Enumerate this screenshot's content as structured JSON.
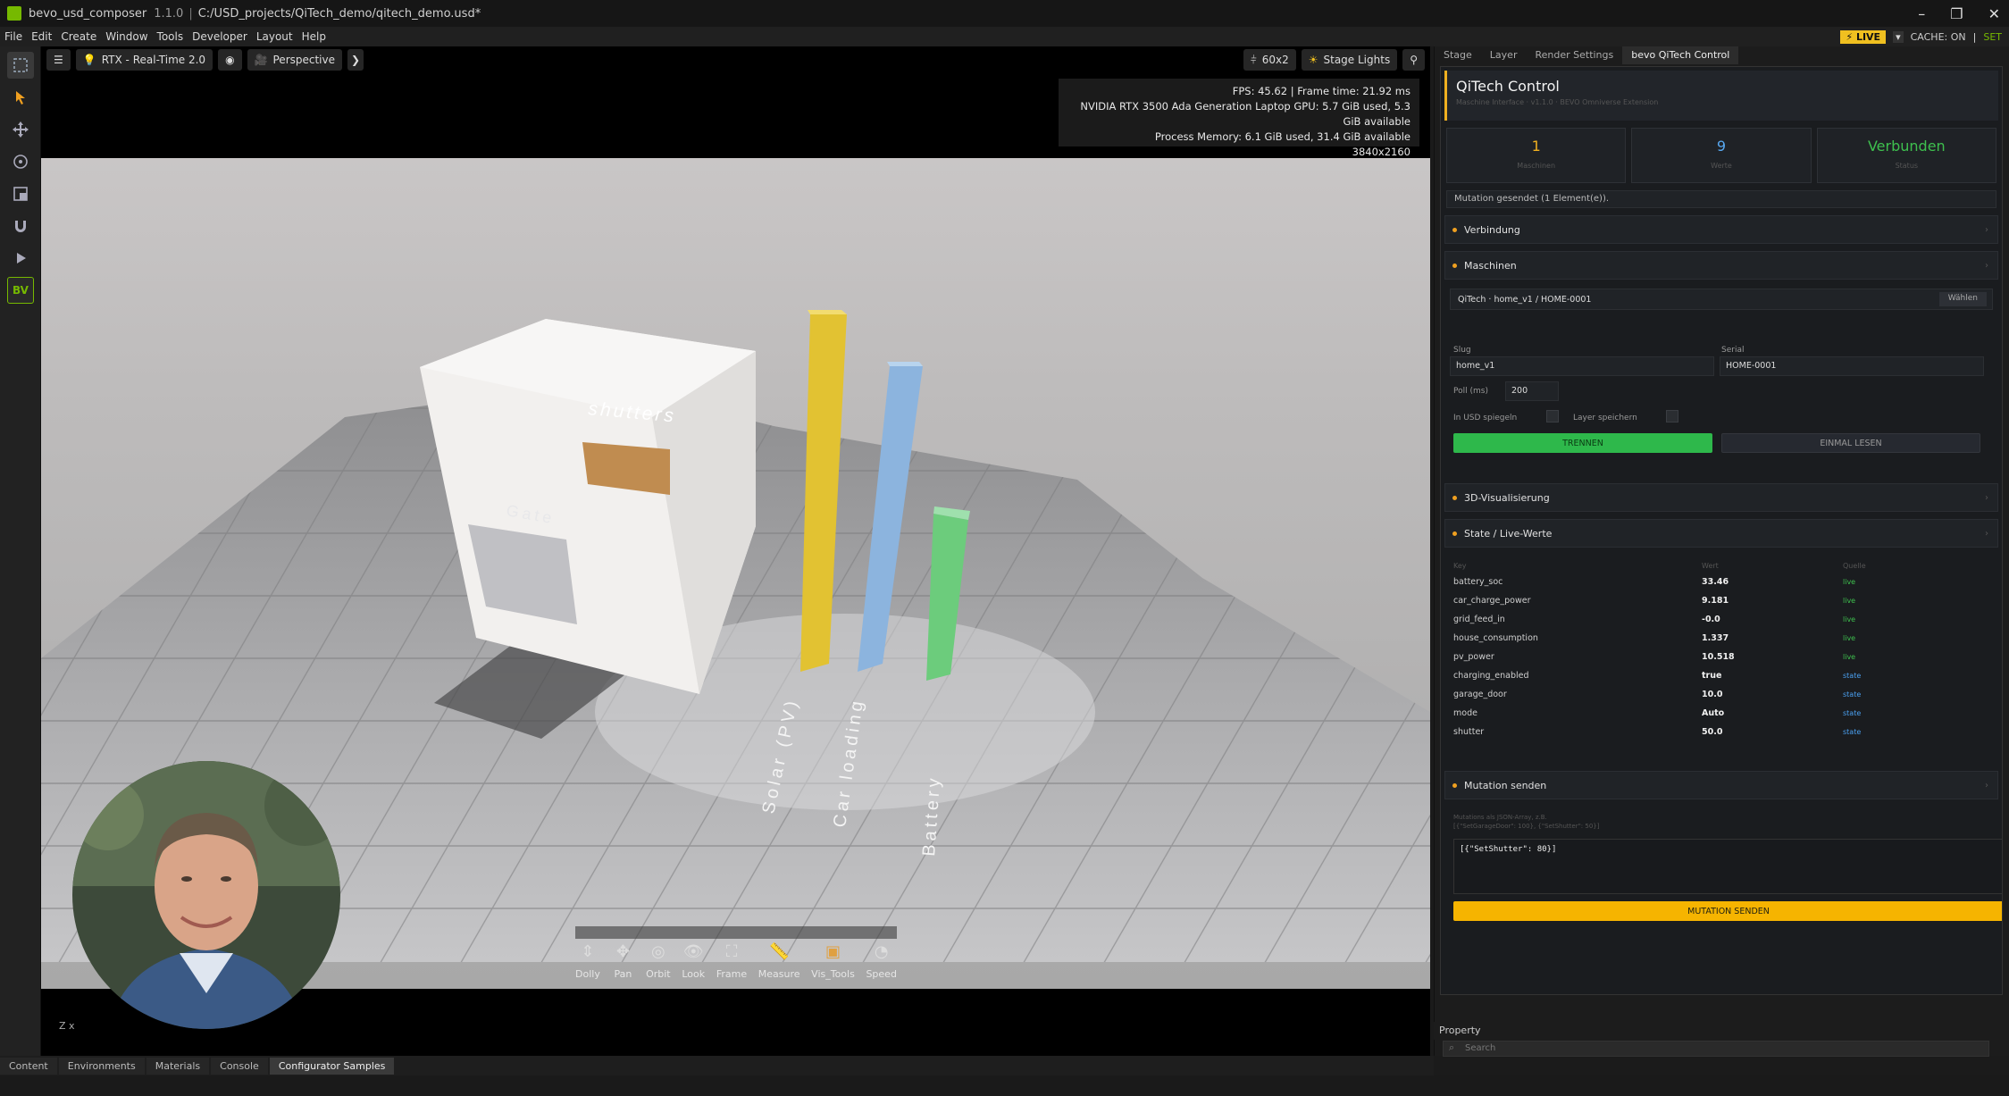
{
  "window": {
    "app_name": "bevo_usd_composer",
    "version": "1.1.0",
    "separator": "|",
    "file_path": "C:/USD_projects/QiTech_demo/qitech_demo.usd*",
    "minimize": "–",
    "maximize": "❐",
    "close": "✕"
  },
  "menu": {
    "items": [
      "File",
      "Edit",
      "Create",
      "Window",
      "Tools",
      "Developer",
      "Layout",
      "Help"
    ],
    "live": "⚡ LIVE",
    "live_dropdown": "▾",
    "cache": "CACHE: ON",
    "cache_sep": "|",
    "set": "SET"
  },
  "viewport": {
    "render_mode": "RTX - Real-Time 2.0",
    "camera": "Perspective",
    "resolution_label": "60x2",
    "lights_label": "Stage Lights",
    "stats": {
      "line1": "FPS: 45.62  |  Frame time: 21.92 ms",
      "line2": "NVIDIA RTX 3500 Ada Generation Laptop GPU: 5.7 GiB used, 5.3 GiB available",
      "line3": "Process Memory: 6.1 GiB used, 31.4 GiB available",
      "line4": "3840x2160"
    },
    "scene": {
      "shutters_label": "shutters",
      "gate_label": "Gate",
      "bar_labels": [
        "Solar (PV)",
        "Car loading",
        "Battery"
      ],
      "bar_colors": [
        "#e8c838",
        "#8fb8e0",
        "#6fd080"
      ]
    },
    "camera_tools": [
      {
        "label": "Dolly",
        "icon": "dolly-icon",
        "glyph": "⇕"
      },
      {
        "label": "Pan",
        "icon": "pan-icon",
        "glyph": "✥"
      },
      {
        "label": "Orbit",
        "icon": "orbit-icon",
        "glyph": "◎"
      },
      {
        "label": "Look",
        "icon": "look-icon",
        "glyph": "👁"
      },
      {
        "label": "Frame",
        "icon": "frame-icon",
        "glyph": "⛶"
      },
      {
        "label": "Measure",
        "icon": "measure-icon",
        "glyph": "📏"
      },
      {
        "label": "Vis_Tools",
        "icon": "vis-tools-icon",
        "glyph": "▣"
      },
      {
        "label": "Speed",
        "icon": "speed-icon",
        "glyph": "◔"
      }
    ],
    "axis_label": "Z x"
  },
  "bottom_tabs": [
    "Content",
    "Environments",
    "Materials",
    "Console",
    "Configurator Samples"
  ],
  "right_panel": {
    "tabs": [
      "Stage",
      "Layer",
      "Render Settings",
      "bevo QiTech Control"
    ],
    "title": "QiTech Control",
    "subtitle": "Maschine Interface  ·  v1.1.0  ·  BEVO Omniverse Extension",
    "stats": [
      {
        "value": "1",
        "label": "Maschinen",
        "color": "#f0b020"
      },
      {
        "value": "9",
        "label": "Werte",
        "color": "#58a8f0"
      },
      {
        "value": "Verbunden",
        "label": "Status",
        "color": "#3ec04e"
      }
    ],
    "message": "Mutation gesendet (1 Element(e)).",
    "sections": {
      "verbindung": "Verbindung",
      "maschinen": "Maschinen",
      "vis3d": "3D-Visualisierung",
      "state": "State / Live-Werte",
      "mutation": "Mutation senden"
    },
    "machine": {
      "name": "QiTech · home_v1 / HOME-0001",
      "select_btn": "Wählen",
      "slug_label": "Slug",
      "slug_value": "home_v1",
      "serial_label": "Serial",
      "serial_value": "HOME-0001",
      "poll_label": "Poll (ms)",
      "poll_value": "200",
      "usd_label": "In USD spiegeln",
      "layer_label": "Layer speichern",
      "disconnect_btn": "TRENNEN",
      "read_once_btn": "EINMAL LESEN"
    },
    "state_table": {
      "headers": [
        "Key",
        "Wert",
        "Quelle"
      ],
      "rows": [
        {
          "key": "battery_soc",
          "value": "33.46",
          "source": "live"
        },
        {
          "key": "car_charge_power",
          "value": "9.181",
          "source": "live"
        },
        {
          "key": "grid_feed_in",
          "value": "-0.0",
          "source": "live"
        },
        {
          "key": "house_consumption",
          "value": "1.337",
          "source": "live"
        },
        {
          "key": "pv_power",
          "value": "10.518",
          "source": "live"
        },
        {
          "key": "charging_enabled",
          "value": "true",
          "source": "state"
        },
        {
          "key": "garage_door",
          "value": "10.0",
          "source": "state"
        },
        {
          "key": "mode",
          "value": "Auto",
          "source": "state"
        },
        {
          "key": "shutter",
          "value": "50.0",
          "source": "state"
        }
      ]
    },
    "mutation": {
      "hint1": "Mutations als JSON-Array, z.B.",
      "hint2": "[{\"SetGarageDoor\": 100}, {\"SetShutter\": 50}]",
      "value": "[{\"SetShutter\": 80}]",
      "send_btn": "MUTATION SENDEN"
    },
    "property_title": "Property",
    "search_placeholder": "Search"
  }
}
